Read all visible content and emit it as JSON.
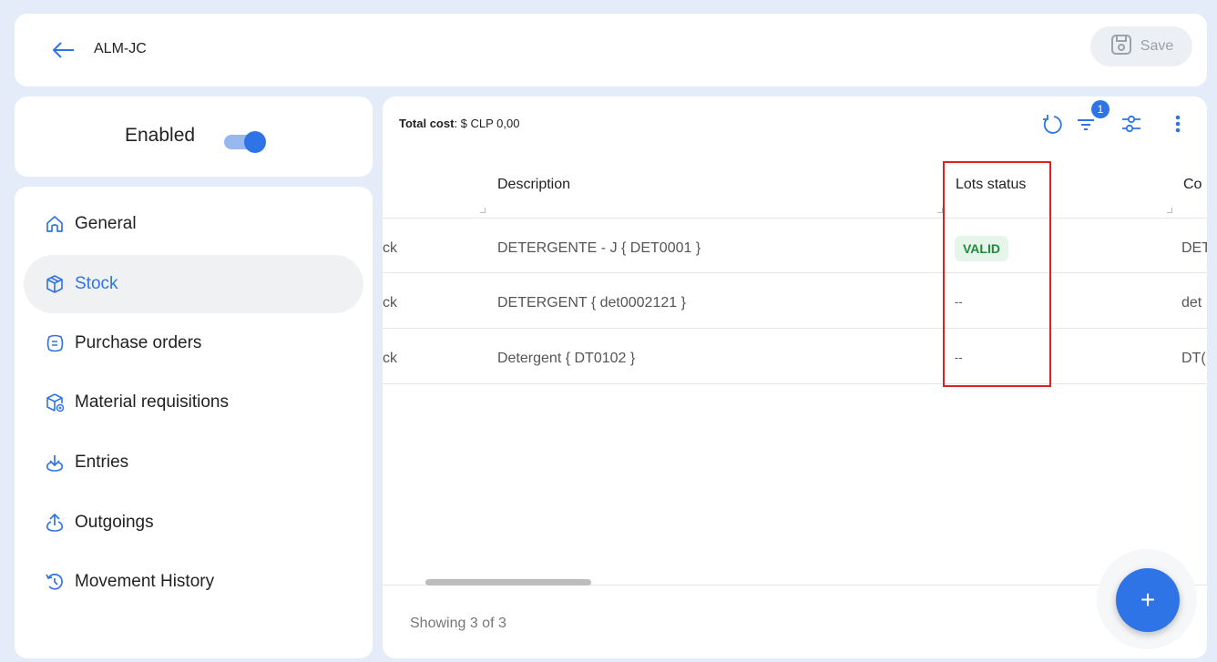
{
  "header": {
    "title": "ALM-JC",
    "save_label": "Save"
  },
  "status_toggle": {
    "label": "Enabled",
    "on": true
  },
  "nav": [
    {
      "label": "General",
      "icon": "home-icon",
      "active": false
    },
    {
      "label": "Stock",
      "icon": "package-icon",
      "active": true
    },
    {
      "label": "Purchase orders",
      "icon": "purchase-order-icon",
      "active": false
    },
    {
      "label": "Material requisitions",
      "icon": "requisition-box-icon",
      "active": false
    },
    {
      "label": "Entries",
      "icon": "download-icon",
      "active": false
    },
    {
      "label": "Outgoings",
      "icon": "upload-icon",
      "active": false
    },
    {
      "label": "Movement History",
      "icon": "history-icon",
      "active": false
    }
  ],
  "main": {
    "total_cost_label": "Total cost",
    "total_cost_value": ": $ CLP 0,00",
    "filter_count": "1",
    "columns": [
      "Description",
      "Lots status",
      "Co"
    ],
    "rows": [
      {
        "col0": "ck",
        "description": "DETERGENTE - J { DET0001 }",
        "lots_status": "VALID",
        "code": "DET"
      },
      {
        "col0": "ck",
        "description": "DETERGENT { det0002121 }",
        "lots_status": "--",
        "code": "det"
      },
      {
        "col0": "ck",
        "description": "Detergent { DT0102 }",
        "lots_status": "--",
        "code": "DT("
      }
    ],
    "footer": "Showing 3 of 3",
    "fab_label": "+"
  },
  "colors": {
    "accent": "#2f74e6",
    "valid_bg": "#e6f5ea",
    "valid_text": "#1e8a3a",
    "highlight": "#e02020"
  }
}
